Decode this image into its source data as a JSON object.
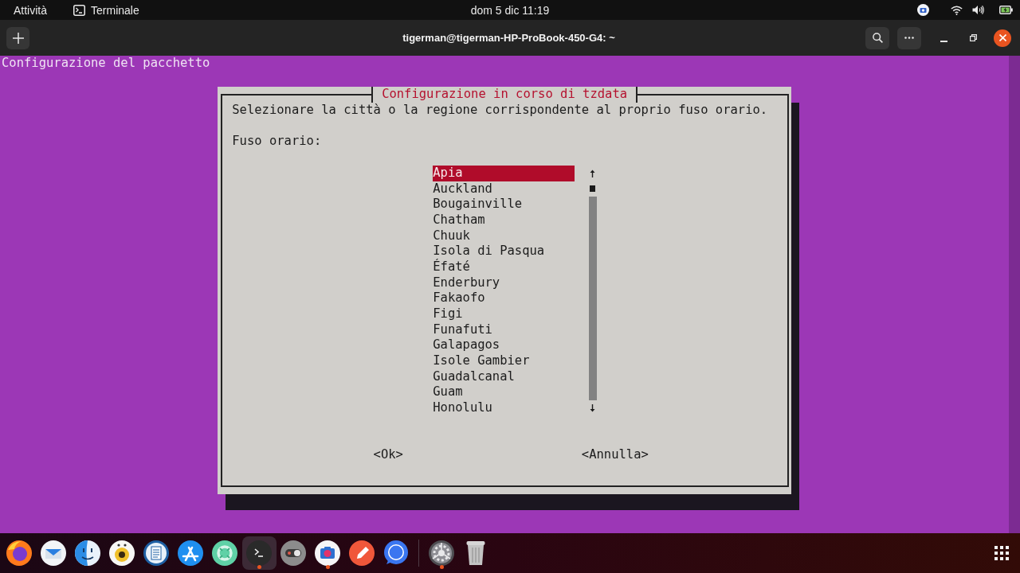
{
  "top_bar": {
    "activities": "Attività",
    "app_menu": "Terminale",
    "clock": "dom 5 dic 11:19"
  },
  "terminal": {
    "title": "tigerman@tigerman-HP-ProBook-450-G4: ~",
    "output_line": "Configurazione del pacchetto",
    "dialog": {
      "title": "Configurazione in corso di tzdata",
      "description": "Selezionare la città o la regione corrispondente al proprio fuso orario.",
      "list_label": "Fuso orario:",
      "items": [
        {
          "label": "Apia",
          "selected": true
        },
        {
          "label": "Auckland",
          "selected": false
        },
        {
          "label": "Bougainville",
          "selected": false
        },
        {
          "label": "Chatham",
          "selected": false
        },
        {
          "label": "Chuuk",
          "selected": false
        },
        {
          "label": "Isola di Pasqua",
          "selected": false
        },
        {
          "label": "Éfaté",
          "selected": false
        },
        {
          "label": "Enderbury",
          "selected": false
        },
        {
          "label": "Fakaofo",
          "selected": false
        },
        {
          "label": "Figi",
          "selected": false
        },
        {
          "label": "Funafuti",
          "selected": false
        },
        {
          "label": "Galapagos",
          "selected": false
        },
        {
          "label": "Isole Gambier",
          "selected": false
        },
        {
          "label": "Guadalcanal",
          "selected": false
        },
        {
          "label": "Guam",
          "selected": false
        },
        {
          "label": "Honolulu",
          "selected": false
        }
      ],
      "buttons": [
        "<Ok>",
        "<Annulla>"
      ]
    }
  },
  "dock": {
    "favorites": [
      {
        "running": false,
        "selected": false
      },
      {
        "running": false,
        "selected": false
      },
      {
        "running": false,
        "selected": false
      },
      {
        "running": false,
        "selected": false
      },
      {
        "running": false,
        "selected": false
      },
      {
        "running": false,
        "selected": false
      },
      {
        "running": false,
        "selected": false
      },
      {
        "running": true,
        "selected": true
      },
      {
        "running": false,
        "selected": false
      },
      {
        "running": true,
        "selected": false
      },
      {
        "running": false,
        "selected": false
      },
      {
        "running": false,
        "selected": false
      }
    ],
    "extras": [
      {
        "running": true,
        "selected": false
      },
      {
        "running": false,
        "selected": false
      }
    ]
  }
}
